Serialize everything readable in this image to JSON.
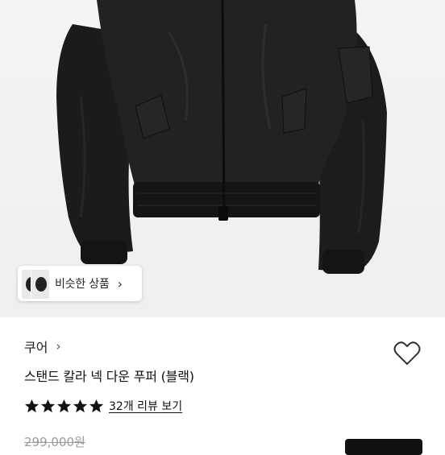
{
  "similar_products": {
    "label": "비슷한 상품",
    "chevron": "›"
  },
  "product": {
    "brand": "쿠어",
    "brand_chevron": "›",
    "title": "스탠드 칼라 넥 다운 푸퍼 (블랙)",
    "rating": {
      "stars": 5,
      "review_link": "32개 리뷰 보기"
    },
    "original_price": "299,000원"
  },
  "colors": {
    "star": "#111111",
    "heart_outline": "#333333",
    "button": "#111111"
  },
  "icons": [
    "chevron-right-icon",
    "heart-icon",
    "star-icon"
  ]
}
